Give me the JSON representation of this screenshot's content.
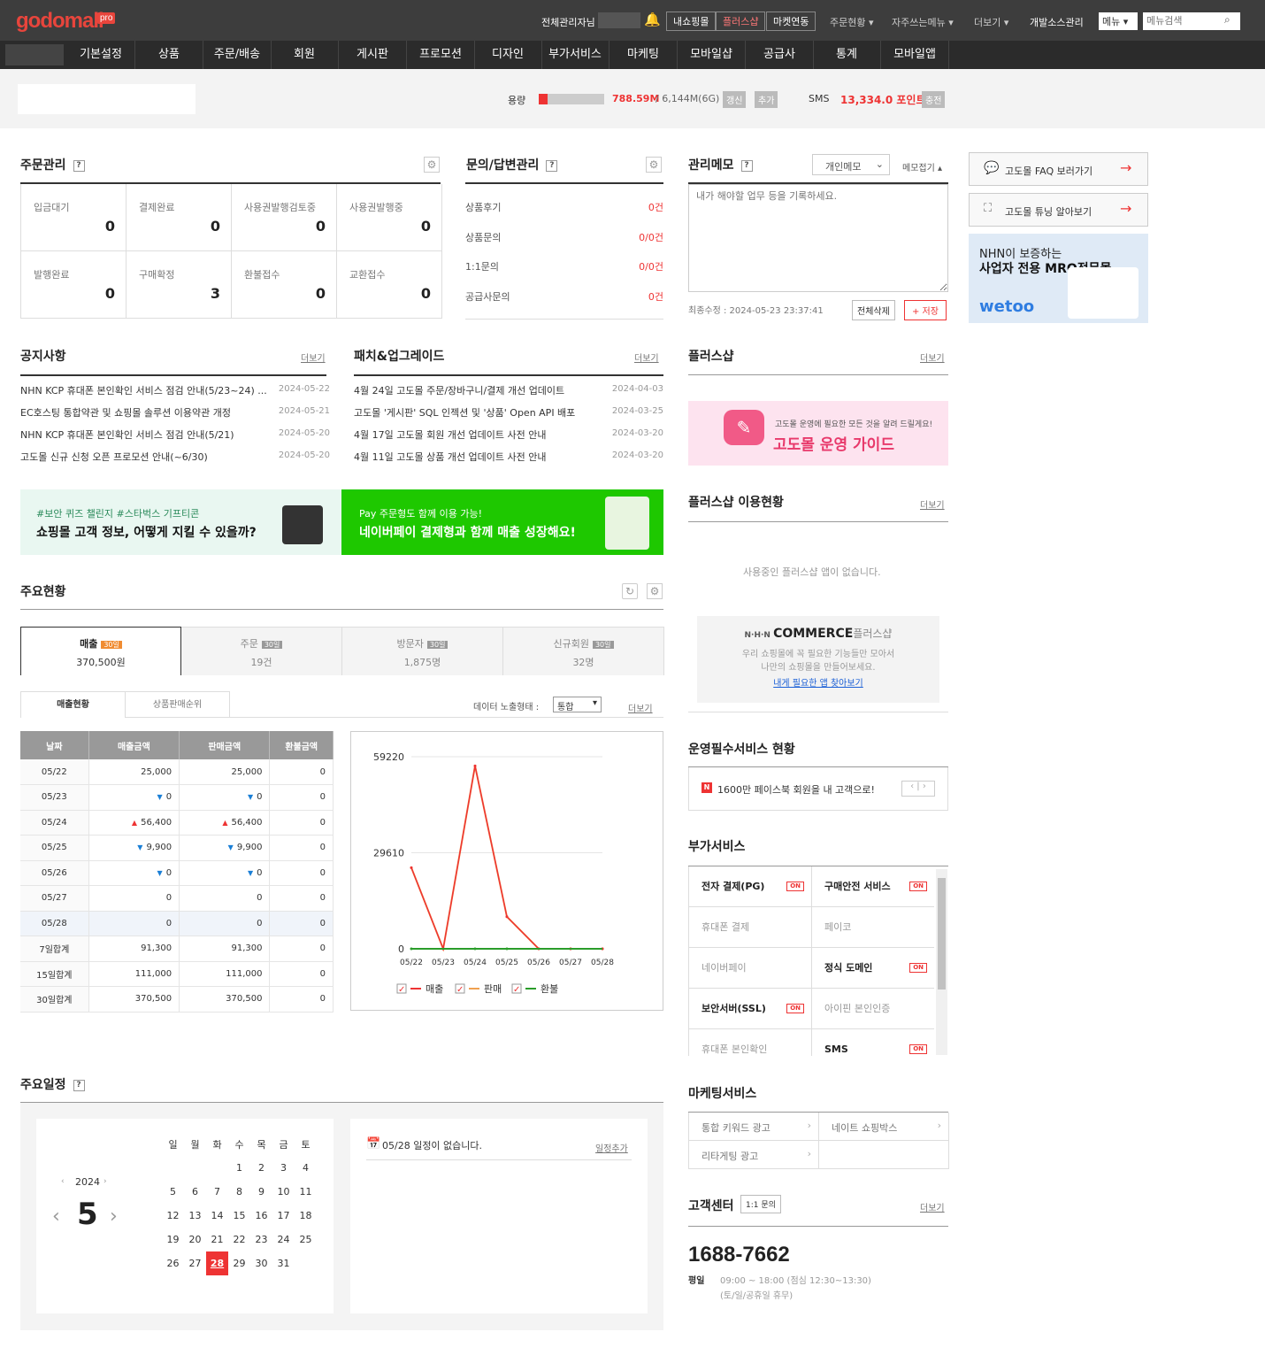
{
  "topbar": {
    "logo": "godomall",
    "badge": "pro",
    "admin": "전체관리자님",
    "btn1": "내쇼핑몰",
    "btn2": "플러스샵",
    "btn3": "마켓연동",
    "m1": "주문현황 ▾",
    "m2": "자주쓰는메뉴 ▾",
    "m3": "더보기 ▾",
    "m4": "개발소스관리",
    "sel": "메뉴",
    "search_placeholder": "메뉴검색"
  },
  "nav": [
    "기본설정",
    "상품",
    "주문/배송",
    "회원",
    "게시판",
    "프로모션",
    "디자인",
    "부가서비스",
    "마케팅",
    "모바일샵",
    "공급사",
    "통계",
    "모바일앱"
  ],
  "usage": {
    "label": "용량",
    "used": "788.59M",
    "total": "/ 6,144M(6G)",
    "b1": "갱신",
    "b2": "추가",
    "sms": "SMS",
    "sms_val": "13,334.0 포인트",
    "b3": "충전",
    "fill": 0.13
  },
  "orders": {
    "title": "주문관리",
    "cells": [
      {
        "l": "입금대기",
        "v": "0"
      },
      {
        "l": "결제완료",
        "v": "0"
      },
      {
        "l": "사용권발행검토중",
        "v": "0"
      },
      {
        "l": "사용권발행중",
        "v": "0"
      },
      {
        "l": "발행완료",
        "v": "0"
      },
      {
        "l": "구매확정",
        "v": "3"
      },
      {
        "l": "환불접수",
        "v": "0"
      },
      {
        "l": "교환접수",
        "v": "0"
      }
    ]
  },
  "inquiry": {
    "title": "문의/답변관리",
    "rows": [
      {
        "l": "상품후기",
        "v": "0건"
      },
      {
        "l": "상품문의",
        "v": "0/0건"
      },
      {
        "l": "1:1문의",
        "v": "0/0건"
      },
      {
        "l": "공급사문의",
        "v": "0건"
      }
    ]
  },
  "memo": {
    "title": "관리메모",
    "sel": "개인메모",
    "fold": "메모접기 ▴",
    "placeholder": "내가 해야할 업무 등을 기록하세요.",
    "modified": "최종수정 : 2024-05-23 23:37:41",
    "del": "전체삭제",
    "save": "+ 저장"
  },
  "side": {
    "faq": "고도몰 FAQ 보러가기",
    "tuning": "고도몰 튜닝 알아보기",
    "ad1": "NHN이 보증하는",
    "ad2": "사업자 전용 MRO전문몰",
    "ad3": "wetoo"
  },
  "notice": {
    "title": "공지사항",
    "more": "더보기",
    "items": [
      {
        "t": "NHN KCP 휴대폰 본인확인 서비스 점검 안내(5/23~24) ...",
        "d": "2024-05-22"
      },
      {
        "t": "EC호스팅 통합약관 및 쇼핑몰 솔루션 이용약관 개정",
        "d": "2024-05-21"
      },
      {
        "t": "NHN KCP 휴대폰 본인확인 서비스 점검 안내(5/21)",
        "d": "2024-05-20"
      },
      {
        "t": "고도몰 신규 신청 오픈 프로모션 안내(~6/30)",
        "d": "2024-05-20"
      }
    ]
  },
  "patch": {
    "title": "패치&업그레이드",
    "more": "더보기",
    "items": [
      {
        "t": "4월 24일 고도몰 주문/장바구니/결제 개선 업데이트",
        "d": "2024-04-03"
      },
      {
        "t": "고도몰 '게시판' SQL 인젝션 및 '상품' Open API 배포",
        "d": "2024-03-25"
      },
      {
        "t": "4월 17일 고도몰 회원 개선 업데이트 사전 안내",
        "d": "2024-03-20"
      },
      {
        "t": "4월 11일 고도몰 상품 개선 업데이트 사전 안내",
        "d": "2024-03-20"
      }
    ]
  },
  "banners": {
    "b1a": "#보안 퀴즈 챌린지 #스타벅스 기프티콘",
    "b1b": "쇼핑몰 고객 정보, 어떻게 지킬 수 있을까?",
    "b2a": "Pay 주문형도 함께 이용 가능!",
    "b2b": "네이버페이 결제형과 함께 매출 성장해요!"
  },
  "status": {
    "title": "주요현황",
    "tabs": [
      {
        "l": "매출",
        "v": "370,500원"
      },
      {
        "l": "주문",
        "v": "19건"
      },
      {
        "l": "방문자",
        "v": "1,875명"
      },
      {
        "l": "신규회원",
        "v": "32명"
      }
    ],
    "badge": "30일",
    "sub1": "매출현황",
    "sub2": "상품판매순위",
    "mode_label": "데이터 노출형태 :",
    "mode": "통합",
    "more": "더보기"
  },
  "sales": {
    "headers": [
      "날짜",
      "매출금액",
      "판매금액",
      "환불금액"
    ],
    "rows": [
      [
        "05/22",
        "25,000",
        "25,000",
        "0",
        ""
      ],
      [
        "05/23",
        "0",
        "0",
        "0",
        "dn"
      ],
      [
        "05/24",
        "56,400",
        "56,400",
        "0",
        "up"
      ],
      [
        "05/25",
        "9,900",
        "9,900",
        "0",
        "dn"
      ],
      [
        "05/26",
        "0",
        "0",
        "0",
        "dn"
      ],
      [
        "05/27",
        "0",
        "0",
        "0",
        ""
      ],
      [
        "05/28",
        "0",
        "0",
        "0",
        ""
      ],
      [
        "7일합계",
        "91,300",
        "91,300",
        "0",
        ""
      ],
      [
        "15일합계",
        "111,000",
        "111,000",
        "0",
        ""
      ],
      [
        "30일합계",
        "370,500",
        "370,500",
        "0",
        ""
      ]
    ]
  },
  "chart_data": {
    "type": "line",
    "categories": [
      "05/22",
      "05/23",
      "05/24",
      "05/25",
      "05/26",
      "05/27",
      "05/28"
    ],
    "series": [
      {
        "name": "매출",
        "values": [
          25000,
          0,
          56400,
          9900,
          0,
          0,
          0
        ],
        "color": "#e33"
      },
      {
        "name": "판매",
        "values": [
          25000,
          0,
          56400,
          9900,
          0,
          0,
          0
        ],
        "color": "#f0a050"
      },
      {
        "name": "환불",
        "values": [
          0,
          0,
          0,
          0,
          0,
          0,
          0
        ],
        "color": "#2a9d2a"
      }
    ],
    "yticks": [
      "59220",
      "29610",
      "0"
    ],
    "ylim": [
      0,
      59220
    ]
  },
  "plus": {
    "title": "플러스샵",
    "more": "더보기",
    "guide1": "고도몰 운영에 필요한 모든 것을 알려 드릴게요!",
    "guide2": "고도몰 운영 가이드",
    "usage_title": "플러스샵 이용현황",
    "usage_more": "더보기",
    "empty": "사용중인 플러스샵 앱이 없습니다.",
    "commerce": "COMMERCE",
    "commerce2": "플러스샵",
    "desc1": "우리 쇼핑몰에 꼭 필요한 기능들만 모아서",
    "desc2": "나만의 쇼핑몰을 만들어보세요.",
    "link": "내게 필요한 앱 찾아보기"
  },
  "ops": {
    "title": "운영필수서비스 현황",
    "item": "1600만 페이스북 회원을 내 고객으로!"
  },
  "addon": {
    "title": "부가서비스",
    "items": [
      {
        "l": "전자 결제(PG)",
        "on": "ON",
        "b": true
      },
      {
        "l": "구매안전 서비스",
        "on": "ON",
        "b": true
      },
      {
        "l": "휴대폰 결제",
        "on": "",
        "b": false
      },
      {
        "l": "페이코",
        "on": "",
        "b": false
      },
      {
        "l": "네이버페이",
        "on": "",
        "b": false
      },
      {
        "l": "정식 도메인",
        "on": "ON",
        "b": true
      },
      {
        "l": "보안서버(SSL)",
        "on": "ON",
        "b": true
      },
      {
        "l": "아이핀 본인인증",
        "on": "",
        "b": false
      },
      {
        "l": "휴대폰 본인확인",
        "on": "",
        "b": false
      },
      {
        "l": "SMS",
        "on": "ON",
        "b": true
      }
    ]
  },
  "mkt": {
    "title": "마케팅서비스",
    "items": [
      "통합 키워드 광고",
      "네이트 쇼핑박스",
      "리타게팅 광고",
      ""
    ]
  },
  "cs": {
    "title": "고객센터",
    "btn": "1:1 문의",
    "more": "더보기",
    "phone": "1688-7662",
    "day": "평일",
    "hours": "09:00 ~ 18:00 (점심 12:30~13:30)",
    "closed": "(토/일/공휴일 휴무)"
  },
  "schedule": {
    "title": "주요일정",
    "year": "2024",
    "month": "5",
    "weekdays": [
      "일",
      "월",
      "화",
      "수",
      "목",
      "금",
      "토"
    ],
    "weeks": [
      [
        "",
        "",
        "",
        "1",
        "2",
        "3",
        "4"
      ],
      [
        "5",
        "6",
        "7",
        "8",
        "9",
        "10",
        "11"
      ],
      [
        "12",
        "13",
        "14",
        "15",
        "16",
        "17",
        "18"
      ],
      [
        "19",
        "20",
        "21",
        "22",
        "23",
        "24",
        "25"
      ],
      [
        "26",
        "27",
        "28",
        "29",
        "30",
        "31",
        ""
      ]
    ],
    "today": "28",
    "empty": "05/28 일정이 없습니다.",
    "add": "일정추가"
  }
}
